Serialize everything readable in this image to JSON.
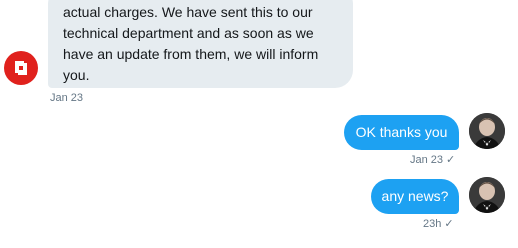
{
  "incoming": {
    "lines": [
      "actual charges. We have sent this to our",
      "technical department and as soon as we",
      "have an update from them, we will inform",
      "you."
    ],
    "time": "Jan 23",
    "avatar_color": "#e0211d"
  },
  "outgoing": [
    {
      "text": "OK thanks you",
      "time": "Jan 23",
      "status_icon": "check-icon",
      "check": "✓"
    },
    {
      "text": "any news?",
      "time": "23h",
      "status_icon": "check-icon",
      "check": "✓"
    }
  ],
  "colors": {
    "incoming_bubble": "#e6ecf0",
    "outgoing_bubble": "#1da1f2",
    "meta_text": "#657786"
  }
}
